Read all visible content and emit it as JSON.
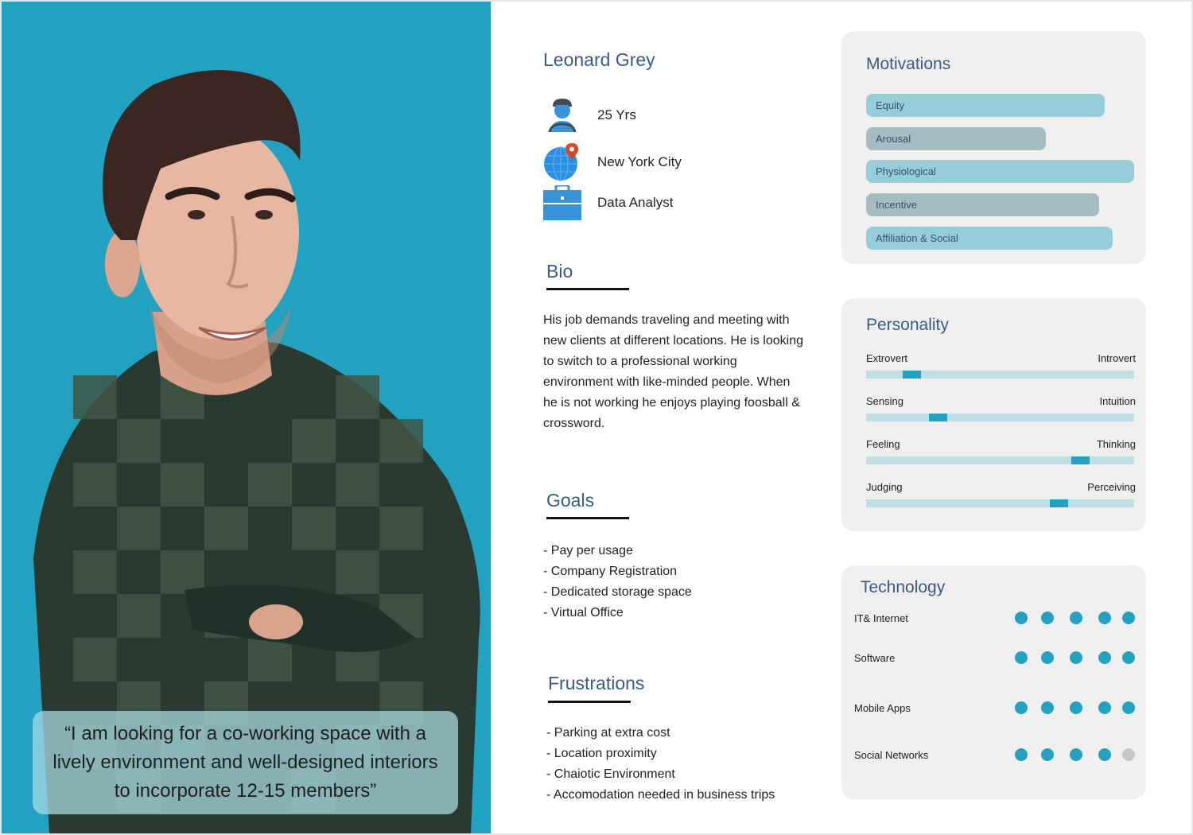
{
  "colors": {
    "photo_background": "#22a2c0",
    "title_text": "#3a5a85",
    "accent": "#22a2c0",
    "motivation_bar_light": "#95cdd9",
    "motivation_bar_dark": "#a5bcc2",
    "personality_track": "#bde0e6",
    "dot_inactive": "#c8c8c8",
    "card_background": "#efefef"
  },
  "photo": {
    "subject": "smiling young man in a dark green plaid shirt with arms crossed",
    "quote": "“I am looking for a co-working space with a lively environment and well-designed interiors to incorporate 12-15 members”"
  },
  "profile": {
    "name": "Leonard Grey",
    "info": [
      {
        "icon": "user-icon",
        "text": "25 Yrs"
      },
      {
        "icon": "globe-location-icon",
        "text": "New York City"
      },
      {
        "icon": "briefcase-icon",
        "text": "Data Analyst"
      }
    ]
  },
  "bio": {
    "title": "Bio",
    "text": "His job demands traveling  and meeting with new clients at different  locations. He is looking to switch to a  professional working environment with  like-minded people. When he is not working  he enjoys playing foosball & crossword."
  },
  "goals": {
    "title": "Goals",
    "items": [
      "- Pay per usage",
      "- Company Registration",
      "- Dedicated storage space",
      "- Virtual Office"
    ]
  },
  "frustrations": {
    "title": "Frustrations",
    "items": [
      "- Parking at extra cost",
      "- Location proximity",
      "- Chaiotic Environment",
      "- Accomodation needed in business trips"
    ]
  },
  "motivations": {
    "title": "Motivations",
    "items": [
      {
        "label": "Equity",
        "value": 0.89,
        "tone": "light"
      },
      {
        "label": "Arousal",
        "value": 0.67,
        "tone": "dark"
      },
      {
        "label": "Physiological",
        "value": 1.0,
        "tone": "light"
      },
      {
        "label": "Incentive",
        "value": 0.87,
        "tone": "dark"
      },
      {
        "label": "Affiliation & Social",
        "value": 0.92,
        "tone": "light"
      }
    ]
  },
  "personality": {
    "title": "Personality",
    "traits": [
      {
        "left": "Extrovert",
        "right": "Introvert",
        "value": 0.17
      },
      {
        "left": "Sensing",
        "right": "Intuition",
        "value": 0.27
      },
      {
        "left": "Feeling",
        "right": "Thinking",
        "value": 0.8
      },
      {
        "left": "Judging",
        "right": "Perceiving",
        "value": 0.72
      }
    ]
  },
  "technology": {
    "title": "Technology",
    "max": 5,
    "items": [
      {
        "label": "IT& Internet",
        "rating": 5
      },
      {
        "label": "Software",
        "rating": 5
      },
      {
        "label": "Mobile Apps",
        "rating": 5
      },
      {
        "label": "Social Networks",
        "rating": 4
      }
    ]
  }
}
